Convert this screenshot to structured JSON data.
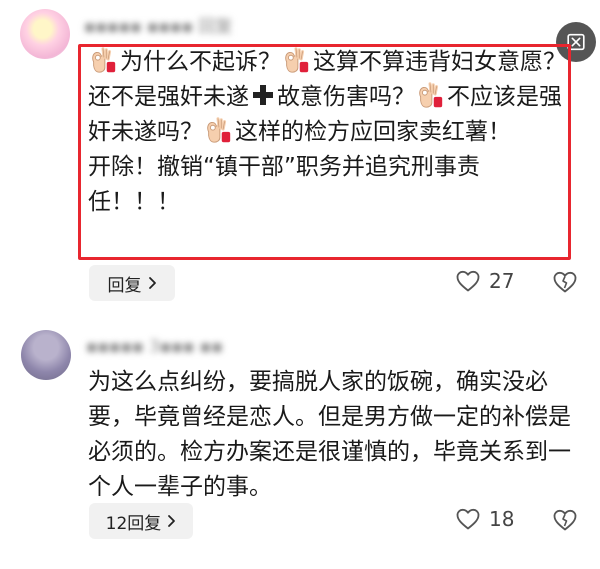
{
  "comment1": {
    "username": "▪▪▪▪▪ ▪▪▪▪  回复",
    "segments": [
      {
        "emoji": "ok-hand"
      },
      {
        "text": "为什么不起诉？"
      },
      {
        "emoji": "ok-hand"
      },
      {
        "text": "这算不算违背妇女意愿？还不是强奸未遂"
      },
      {
        "emoji": "plus"
      },
      {
        "text": "故意伤害吗？"
      },
      {
        "emoji": "ok-hand"
      },
      {
        "text": "不应该是强奸未遂吗？"
      },
      {
        "emoji": "ok-hand"
      },
      {
        "text": "这样的检方应回家卖红薯！"
      },
      {
        "br": true
      },
      {
        "text": "开除！撤销“镇干部”职务并追究刑事责任！！！"
      }
    ],
    "reply_label": "回复",
    "like_count": "27",
    "highlight_color": "#e8262f"
  },
  "comment2": {
    "username": "▪▪▪▪▪  3▪▪▪  ▪▪",
    "text": "为这么点纠纷，要搞脱人家的饭碗，确实没必要，毕竟曾经是恋人。但是男方做一定的补偿是必须的。检方办案还是很谨慎的，毕竟关系到一个人一辈子的事。",
    "reply_label": "12回复",
    "like_count": "18"
  },
  "icons": {
    "close": "close-icon",
    "like": "heart-outline-icon",
    "dislike": "broken-heart-icon",
    "ok_hand": "ok-hand-emoji-icon",
    "plus": "heavy-plus-icon",
    "chevron": "chevron-right-icon"
  }
}
